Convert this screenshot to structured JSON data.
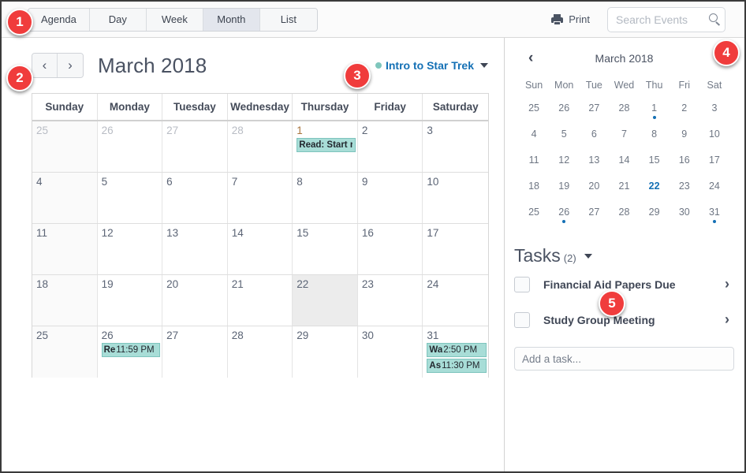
{
  "topbar": {
    "tabs": [
      {
        "label": "Agenda",
        "active": false
      },
      {
        "label": "Day",
        "active": false
      },
      {
        "label": "Week",
        "active": false
      },
      {
        "label": "Month",
        "active": true
      },
      {
        "label": "List",
        "active": false
      }
    ],
    "print_label": "Print",
    "print_icon": "printer-icon",
    "search_placeholder": "Search Events",
    "search_value": "",
    "search_icon": "magnifier-icon"
  },
  "calendar": {
    "prev_label": "‹",
    "next_label": "›",
    "title": "March 2018",
    "course_filter": {
      "name": "Intro to Star Trek",
      "dot_color": "#7fc6bc",
      "caret_icon": "chevron-down-icon"
    },
    "weekday_headers": [
      "Sunday",
      "Monday",
      "Tuesday",
      "Wednesday",
      "Thursday",
      "Friday",
      "Saturday"
    ],
    "weeks": [
      [
        {
          "num": "25",
          "other": true,
          "today": false,
          "events": []
        },
        {
          "num": "26",
          "other": true,
          "today": false,
          "events": []
        },
        {
          "num": "27",
          "other": true,
          "today": false,
          "events": []
        },
        {
          "num": "28",
          "other": true,
          "today": false,
          "events": []
        },
        {
          "num": "1",
          "other": false,
          "today": false,
          "first": true,
          "events": [
            {
              "title": "Read: Start r",
              "time": ""
            }
          ]
        },
        {
          "num": "2",
          "other": false,
          "today": false,
          "events": []
        },
        {
          "num": "3",
          "other": false,
          "today": false,
          "events": []
        }
      ],
      [
        {
          "num": "4",
          "other": false,
          "today": false,
          "events": []
        },
        {
          "num": "5",
          "other": false,
          "today": false,
          "events": []
        },
        {
          "num": "6",
          "other": false,
          "today": false,
          "events": []
        },
        {
          "num": "7",
          "other": false,
          "today": false,
          "events": []
        },
        {
          "num": "8",
          "other": false,
          "today": false,
          "events": []
        },
        {
          "num": "9",
          "other": false,
          "today": false,
          "events": []
        },
        {
          "num": "10",
          "other": false,
          "today": false,
          "events": []
        }
      ],
      [
        {
          "num": "11",
          "other": false,
          "today": false,
          "events": []
        },
        {
          "num": "12",
          "other": false,
          "today": false,
          "events": []
        },
        {
          "num": "13",
          "other": false,
          "today": false,
          "events": []
        },
        {
          "num": "14",
          "other": false,
          "today": false,
          "events": []
        },
        {
          "num": "15",
          "other": false,
          "today": false,
          "events": []
        },
        {
          "num": "16",
          "other": false,
          "today": false,
          "events": []
        },
        {
          "num": "17",
          "other": false,
          "today": false,
          "events": []
        }
      ],
      [
        {
          "num": "18",
          "other": false,
          "today": false,
          "events": []
        },
        {
          "num": "19",
          "other": false,
          "today": false,
          "events": []
        },
        {
          "num": "20",
          "other": false,
          "today": false,
          "events": []
        },
        {
          "num": "21",
          "other": false,
          "today": false,
          "events": []
        },
        {
          "num": "22",
          "other": false,
          "today": true,
          "events": []
        },
        {
          "num": "23",
          "other": false,
          "today": false,
          "events": []
        },
        {
          "num": "24",
          "other": false,
          "today": false,
          "events": []
        }
      ],
      [
        {
          "num": "25",
          "other": false,
          "today": false,
          "events": []
        },
        {
          "num": "26",
          "other": false,
          "today": false,
          "events": [
            {
              "title": "Re",
              "time": "11:59 PM"
            }
          ]
        },
        {
          "num": "27",
          "other": false,
          "today": false,
          "events": []
        },
        {
          "num": "28",
          "other": false,
          "today": false,
          "events": []
        },
        {
          "num": "29",
          "other": false,
          "today": false,
          "events": []
        },
        {
          "num": "30",
          "other": false,
          "today": false,
          "events": []
        },
        {
          "num": "31",
          "other": false,
          "today": false,
          "events": [
            {
              "title": "Wa",
              "time": "2:50 PM"
            },
            {
              "title": "As",
              "time": "11:30 PM"
            }
          ]
        }
      ]
    ]
  },
  "mini_calendar": {
    "prev_icon": "chevron-left-icon",
    "next_icon": "chevron-right-icon",
    "prev_label": "‹",
    "next_label": "›",
    "title": "March 2018",
    "weekday_headers": [
      "Sun",
      "Mon",
      "Tue",
      "Wed",
      "Thu",
      "Fri",
      "Sat"
    ],
    "weeks": [
      [
        {
          "num": "25",
          "dot": false,
          "selected": false
        },
        {
          "num": "26",
          "dot": false,
          "selected": false
        },
        {
          "num": "27",
          "dot": false,
          "selected": false
        },
        {
          "num": "28",
          "dot": false,
          "selected": false
        },
        {
          "num": "1",
          "dot": true,
          "selected": false
        },
        {
          "num": "2",
          "dot": false,
          "selected": false
        },
        {
          "num": "3",
          "dot": false,
          "selected": false
        }
      ],
      [
        {
          "num": "4",
          "dot": false,
          "selected": false
        },
        {
          "num": "5",
          "dot": false,
          "selected": false
        },
        {
          "num": "6",
          "dot": false,
          "selected": false
        },
        {
          "num": "7",
          "dot": false,
          "selected": false
        },
        {
          "num": "8",
          "dot": false,
          "selected": false
        },
        {
          "num": "9",
          "dot": false,
          "selected": false
        },
        {
          "num": "10",
          "dot": false,
          "selected": false
        }
      ],
      [
        {
          "num": "11",
          "dot": false,
          "selected": false
        },
        {
          "num": "12",
          "dot": false,
          "selected": false
        },
        {
          "num": "13",
          "dot": false,
          "selected": false
        },
        {
          "num": "14",
          "dot": false,
          "selected": false
        },
        {
          "num": "15",
          "dot": false,
          "selected": false
        },
        {
          "num": "16",
          "dot": false,
          "selected": false
        },
        {
          "num": "17",
          "dot": false,
          "selected": false
        }
      ],
      [
        {
          "num": "18",
          "dot": false,
          "selected": false
        },
        {
          "num": "19",
          "dot": false,
          "selected": false
        },
        {
          "num": "20",
          "dot": false,
          "selected": false
        },
        {
          "num": "21",
          "dot": false,
          "selected": false
        },
        {
          "num": "22",
          "dot": false,
          "selected": true
        },
        {
          "num": "23",
          "dot": false,
          "selected": false
        },
        {
          "num": "24",
          "dot": false,
          "selected": false
        }
      ],
      [
        {
          "num": "25",
          "dot": false,
          "selected": false
        },
        {
          "num": "26",
          "dot": true,
          "selected": false
        },
        {
          "num": "27",
          "dot": false,
          "selected": false
        },
        {
          "num": "28",
          "dot": false,
          "selected": false
        },
        {
          "num": "29",
          "dot": false,
          "selected": false
        },
        {
          "num": "30",
          "dot": false,
          "selected": false
        },
        {
          "num": "31",
          "dot": true,
          "selected": false
        }
      ]
    ]
  },
  "tasks": {
    "title": "Tasks",
    "count": "(2)",
    "caret_icon": "chevron-down-icon",
    "items": [
      {
        "label": "Financial Aid Papers Due",
        "checked": false,
        "chevron": "›"
      },
      {
        "label": "Study Group Meeting",
        "checked": false,
        "chevron": "›"
      }
    ],
    "add_placeholder": "Add a task...",
    "add_value": ""
  },
  "annotations": [
    {
      "id": "b1",
      "label": "1"
    },
    {
      "id": "b2",
      "label": "2"
    },
    {
      "id": "b3",
      "label": "3"
    },
    {
      "id": "b4",
      "label": "4"
    },
    {
      "id": "b5",
      "label": "5"
    }
  ],
  "colors": {
    "accent": "#1470b5",
    "event_bg": "#a8ddd7",
    "event_border": "#7ec4bd",
    "badge": "#f03c3c"
  }
}
